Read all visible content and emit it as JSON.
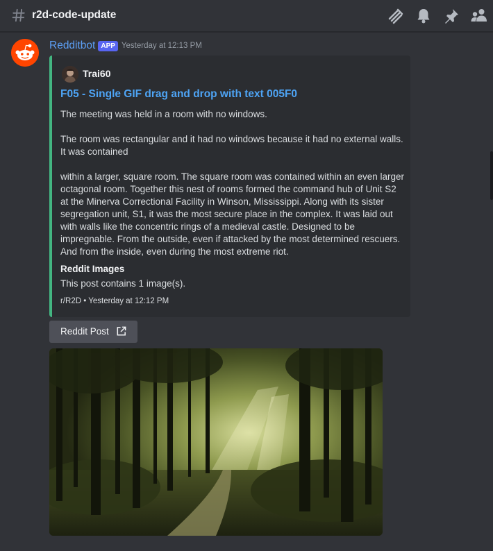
{
  "channel": {
    "name": "r2d-code-update",
    "icons": [
      "threads-icon",
      "bell-icon",
      "pin-icon",
      "members-icon"
    ]
  },
  "message": {
    "author": "Redditbot",
    "tag": "APP",
    "timestamp": "Yesterday at 12:13 PM",
    "avatar_icon": "reddit-snoo-icon",
    "embed": {
      "accent_color": "#43b581",
      "author_name": "Trai60",
      "title": "F05 - Single GIF drag and drop with text 005F0",
      "paragraphs": [
        "The meeting was held in a room with no windows.",
        "The room was rectangular and it had no windows because it had no external walls. It was contained",
        "within a larger, square room. The square room was contained within an even larger octagonal room. Together this nest of rooms formed the command hub of Unit S2 at the Minerva Correctional Facility in Winson, Mississippi. Along with its sister segregation unit, S1, it was the most secure place in the complex. It was laid out with walls like the concentric rings of a medieval castle. Designed to be impregnable. From the outside, even if attacked by the most determined rescuers. And from the inside, even during the most extreme riot."
      ],
      "field": {
        "name": "Reddit Images",
        "value": "This post contains 1 image(s)."
      },
      "footer": "r/R2D • Yesterday at 12:12 PM"
    },
    "button": {
      "label": "Reddit Post",
      "icon": "external-link-icon"
    },
    "image": {
      "description_icon": "forest-image"
    }
  },
  "colors": {
    "background": "#313338",
    "embed_bg": "#2b2d31",
    "link": "#4ea4f5",
    "author": "#5c9ff5",
    "app_tag": "#5865f2"
  }
}
